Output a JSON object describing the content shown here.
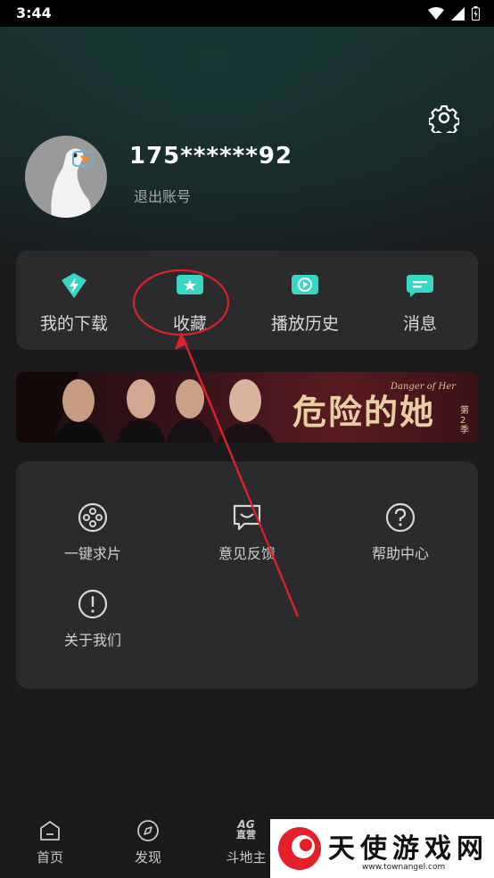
{
  "status_bar": {
    "time": "3:44"
  },
  "profile": {
    "username": "175******92",
    "logout_label": "退出账号"
  },
  "quick_actions": [
    {
      "label": "我的下载",
      "icon": "download-icon"
    },
    {
      "label": "收藏",
      "icon": "favorite-star-icon"
    },
    {
      "label": "播放历史",
      "icon": "play-history-icon"
    },
    {
      "label": "消息",
      "icon": "message-icon"
    }
  ],
  "banner": {
    "title": "危险的她",
    "subtitle": "Danger of Her",
    "season": "第2季"
  },
  "tools": [
    {
      "label": "一键求片",
      "icon": "film-reel-icon"
    },
    {
      "label": "意见反馈",
      "icon": "feedback-icon"
    },
    {
      "label": "帮助中心",
      "icon": "help-icon"
    },
    {
      "label": "关于我们",
      "icon": "info-icon"
    }
  ],
  "tabs": [
    {
      "label": "首页",
      "icon": "home-icon"
    },
    {
      "label": "发现",
      "icon": "compass-icon"
    },
    {
      "label": "斗地主",
      "icon": "ag-icon",
      "icon_text_top": "AG",
      "icon_text_bottom": "直营"
    }
  ],
  "watermark": {
    "text": "天使游戏网",
    "url": "www.townangel.com"
  },
  "colors": {
    "accent_teal": "#3ad6c4",
    "annotation_red": "#d8232a",
    "card_bg": "#2b2b2e"
  }
}
